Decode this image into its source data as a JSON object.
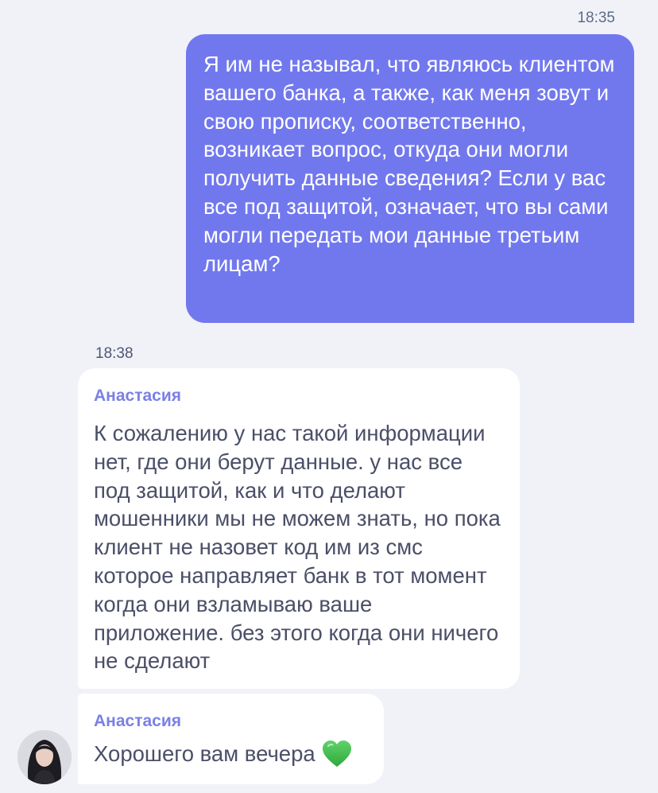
{
  "messages": {
    "outgoing": {
      "time": "18:35",
      "text": "Я им не называл, что являюсь клиентом вашего банка, а также, как меня зовут и свою прописку, соответственно, возникает вопрос, откуда они могли получить данные сведения? Если у вас все под защитой, означает, что вы сами могли передать мои данные третьим лицам?"
    },
    "incoming_time": "18:38",
    "incoming": [
      {
        "sender": "Анастасия",
        "text": "К сожалению у нас такой информации нет, где они берут данные. у нас все под защитой, как и что делают мошенники мы не можем знать, но пока клиент не назовет код им из смс которое направляет банк в тот момент когда они взламываю ваше приложение. без этого когда они ничего не сделают"
      },
      {
        "sender": "Анастасия",
        "text": "Хорошего вам вечера",
        "emoji": "green-heart-icon"
      }
    ]
  },
  "colors": {
    "outgoing_bubble": "#7178ee",
    "sender_name": "#7a80e6",
    "background": "#f1f2f8"
  }
}
